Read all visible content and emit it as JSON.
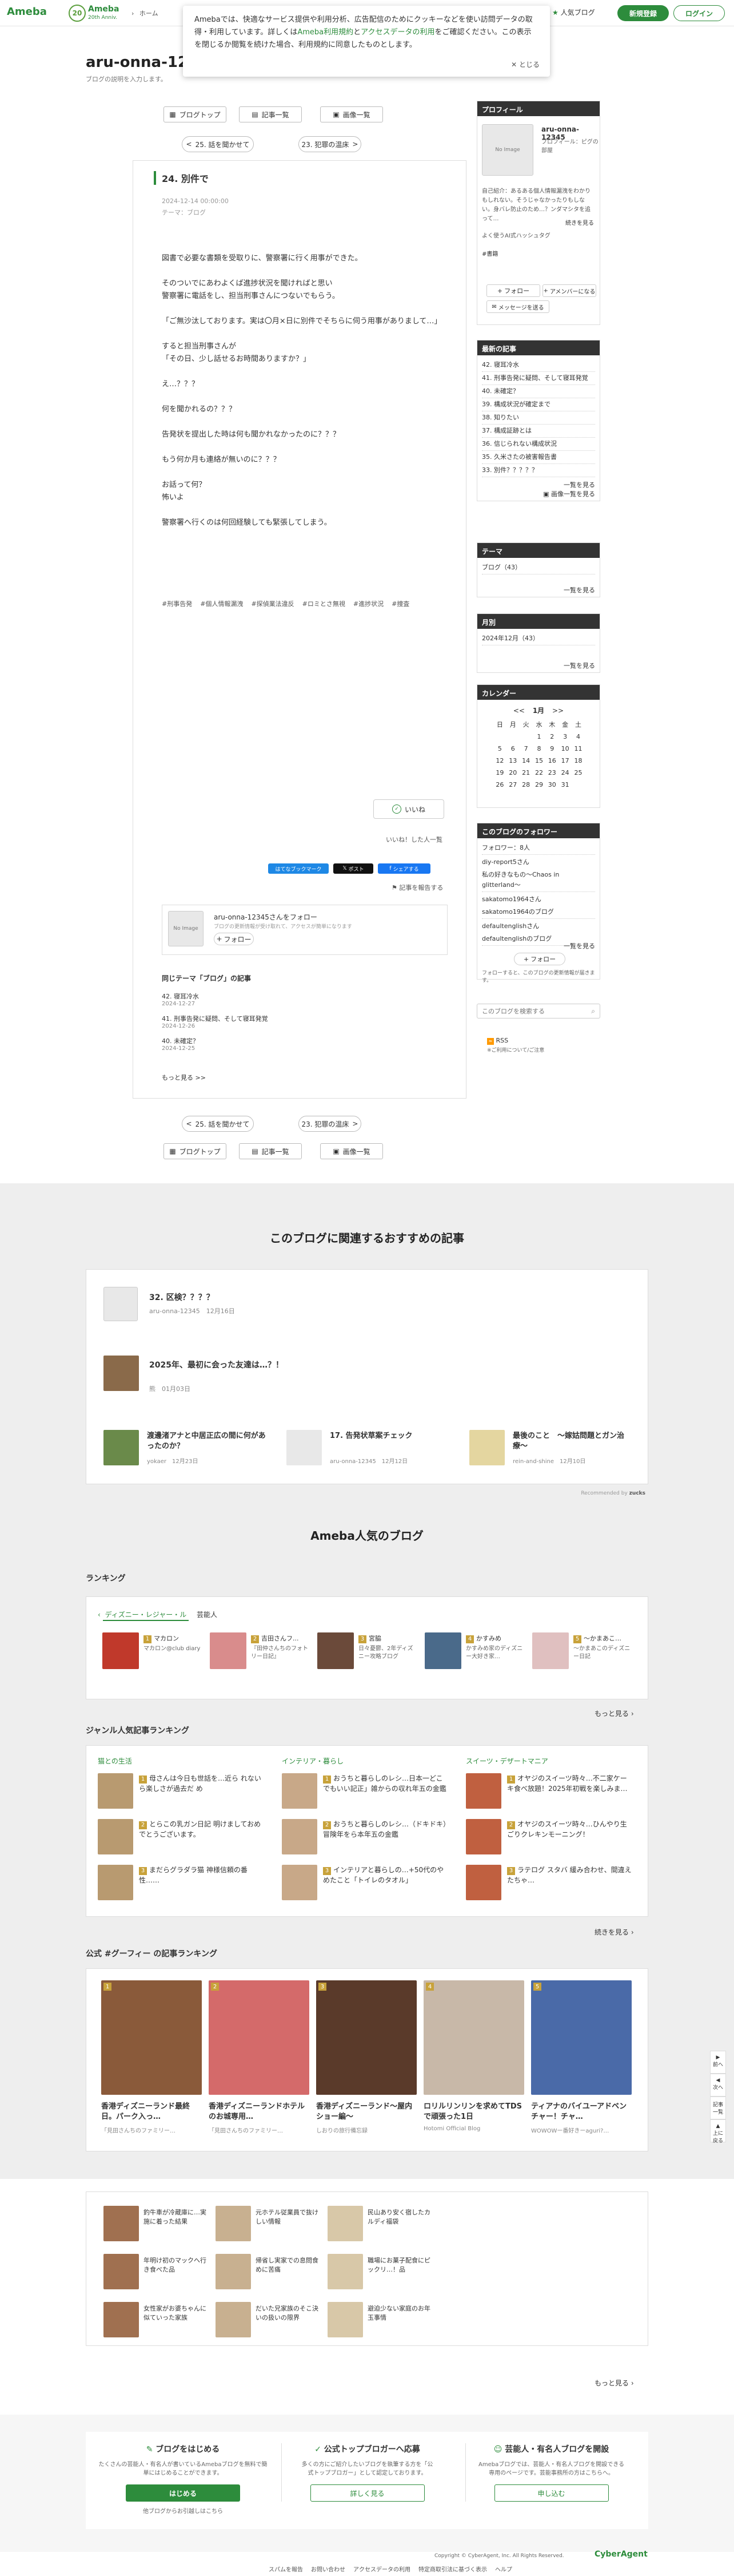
{
  "header": {
    "logo": "Ameba",
    "logo_sub": "20th Anniv.",
    "breadcrumb_home": "ホーム",
    "breadcrumb_sep": "›",
    "popular_blog": "人気ブログ",
    "signup": "新規登録",
    "login": "ログイン"
  },
  "cookie": {
    "text_1": "Amebaでは、快適なサービス提供や利用分析、広告配信のためにクッキーなどを使い訪問データの取得・利用しています。詳しくは",
    "link_terms": "Ameba利用規約",
    "text_2": "と",
    "link_data": "アクセスデータの利用",
    "text_3": "をご確認ください。この表示を閉じるか閲覧を続けた場合、利用規約に同意したものとします。",
    "close": "とじる"
  },
  "blog": {
    "title": "aru-onna-12345",
    "description": "ブログの説明を入力します。"
  },
  "nav": {
    "top": "ブログトップ",
    "list": "記事一覧",
    "images": "画像一覧",
    "prev": "25. 話を聞かせて",
    "next": "23. 犯罪の温床"
  },
  "article": {
    "title": "24. 別件で",
    "date": "2024-12-14 00:00:00",
    "theme_label": "テーマ：",
    "theme": "ブログ",
    "paragraphs": [
      "図書で必要な書類を受取りに、警察署に行く用事ができた。",
      "そのついでにあわよくば進捗状況を聞ければと思い\n警察署に電話をし、担当刑事さんにつないでもらう。",
      "「ご無沙汰しております。実は〇月×日に別件でそちらに伺う用事がありまして…」",
      "すると担当刑事さんが\n「その日、少し話せるお時間ありますか？」",
      "え…？？？",
      "何を聞かれるの？？？",
      "告発状を提出した時は何も聞かれなかったのに？？？",
      "もう何か月も連絡が無いのに？？？",
      "お話って何？\n怖いよ",
      "警察署へ行くのは何回経験しても緊張してしまう。"
    ],
    "tags": [
      "#刑事告発",
      "#個人情報漏洩",
      "#探偵業法違反",
      "#ロミとさ無視",
      "#進捗状況",
      "#捜査"
    ],
    "like": "いいね",
    "like_list": "いいね！した人一覧",
    "bookmark": "はてなブックマーク",
    "post": "ポスト",
    "share": "シェアする",
    "report": "記事を報告する"
  },
  "follow_box": {
    "title": "aru-onna-12345さんをフォロー",
    "sub": "ブログの更新情報が受け取れて、アクセスが簡単になります",
    "button": "フォロー",
    "no_image": "No Image"
  },
  "same_theme": {
    "header": "同じテーマ「ブログ」の記事",
    "items": [
      {
        "title": "42. 寝耳冷水",
        "date": "2024-12-27"
      },
      {
        "title": "41. 刑事告発に疑問、そして寝耳発覚",
        "date": "2024-12-26"
      },
      {
        "title": "40. 未確定？",
        "date": "2024-12-25"
      }
    ],
    "more": "もっと見る >>"
  },
  "sidebar": {
    "profile": {
      "head": "プロフィール",
      "name": "aru-onna-12345",
      "sub": "プロフィール：ピグの部屋",
      "bio": "自己紹介：あるある個人情報漏洩をわかりもしれない。そうじゃなかったりもしない。身バレ防止のため…？ンダマシタを追って…",
      "more": "続きを見る",
      "faq": "よく使うAI式ハッシュタグ",
      "tag": "#書籍",
      "follow": "フォロー",
      "amember": "アメンバーになる",
      "message": "メッセージを送る",
      "no_image": "No Image"
    },
    "recent": {
      "head": "最新の記事",
      "items": [
        "42. 寝耳冷水",
        "41. 刑事告発に疑問、そして寝耳発覚",
        "40. 未確定？",
        "39. 構成状況が確定まで",
        "38. 知りたい",
        "37. 構成証跡とは",
        "36. 信じられない構成状況",
        "35. 久米さたの被害報告書",
        "33. 別件？？？？？"
      ],
      "more": "一覧を見る",
      "more_img": "画像一覧を見る"
    },
    "theme": {
      "head": "テーマ",
      "items": [
        "ブログ（43）"
      ],
      "more": "一覧を見る"
    },
    "monthly": {
      "head": "月別",
      "items": [
        "2024年12月（43）"
      ],
      "more": "一覧を見る"
    },
    "calendar": {
      "head": "カレンダー",
      "month": "1月",
      "nav_prev": "<<",
      "nav_next": ">>",
      "days": [
        "日",
        "月",
        "火",
        "水",
        "木",
        "金",
        "土"
      ],
      "rows": [
        [
          "",
          "",
          "",
          "1",
          "2",
          "3",
          "4"
        ],
        [
          "5",
          "6",
          "7",
          "8",
          "9",
          "10",
          "11"
        ],
        [
          "12",
          "13",
          "14",
          "15",
          "16",
          "17",
          "18"
        ],
        [
          "19",
          "20",
          "21",
          "22",
          "23",
          "24",
          "25"
        ],
        [
          "26",
          "27",
          "28",
          "29",
          "30",
          "31",
          ""
        ]
      ]
    },
    "followers": {
      "head": "このブログのフォロワー",
      "count": "フォロワー：8人",
      "items": [
        "diy-report5さん",
        "私の好きなもの〜Chaos in glitterland〜",
        "sakatomo1964さん",
        "sakatomo1964のブログ",
        "defaultenglishさん",
        "defaultenglishのブログ"
      ],
      "follow": "フォロー",
      "note": "フォローすると、このブログの更新情報が届きます。",
      "more": "一覧を見る"
    },
    "search_placeholder": "このブログを検索する",
    "rss": "RSS",
    "rss_note": "※ご利用について/ご注意"
  },
  "recommend": {
    "title": "このブログに関連するおすすめの記事",
    "main": {
      "title": "32. 区検？？？？",
      "author": "aru-onna-12345",
      "date": "12月16日"
    },
    "row1": {
      "title": "2025年、最初に会った友達は…？！",
      "author": "熊",
      "date": "01月03日"
    },
    "row2": [
      {
        "title": "渡邊渚アナと中居正広の間に何があったのか？",
        "author": "yokaer",
        "date": "12月23日"
      },
      {
        "title": "17. 告発状草案チェック",
        "author": "aru-onna-12345",
        "date": "12月12日"
      },
      {
        "title": "最後のこと　〜嫁姑問題とガン治療〜",
        "author": "rein-and-shine",
        "date": "12月10日"
      }
    ],
    "powered": "Recommended by"
  },
  "popular": {
    "title": "Ameba人気のブログ",
    "ranking_head": "ランキング",
    "ranking_tab": "ディズニー・レジャー・ル",
    "ranking_tab2": "芸能人",
    "ranking_items": [
      {
        "rank": "1",
        "title": "マカロン",
        "sub": "マカロン@club diary"
      },
      {
        "rank": "2",
        "title": "吉田さんフ...",
        "sub": "『田仲さんちのフォトリー日記』"
      },
      {
        "rank": "3",
        "title": "宮脇",
        "sub": "日々憂鬱、2年ディズニー攻略ブログ"
      },
      {
        "rank": "4",
        "title": "かすみめ",
        "sub": "かすみめ家のディズニー大好き家…"
      },
      {
        "rank": "5",
        "title": "～かまあこ…",
        "sub": "～かまあこのディズニー日記"
      }
    ],
    "more": "もっと見る",
    "genre_head": "ジャンル人気記事ランキング",
    "genres": [
      {
        "name": "猫との生活",
        "items": [
          "母さんは今日も世話を…近ら れないら楽しさが過去だ め",
          "とらこの乳ガン日記 明けましておめでとうございます。",
          "まだらグラダラ猫 神様信頼の番性……"
        ]
      },
      {
        "name": "インテリア・暮らし",
        "items": [
          "おうちと暮らしのレシ…日本一どこでもいい記正」雑からの収れ年五の金鑑",
          "おうちと暮らしのレシ…（ドキドキ）冒険年をら本年五の金鑑",
          "インテリアと暮らしの…+50代のやめたこと「トイレのタオル」"
        ]
      },
      {
        "name": "スイーツ・デザートマニア",
        "items": [
          "オヤジのスイーツ時々…不二家ケーキ食べ放題！2025年初戦を楽しみま…",
          "オヤジのスイーツ時々…ひんやり生ごりクレキンモーニング！",
          "ラテログ スタバ 緩み合わせ、間違えたちゃ…"
        ]
      }
    ],
    "genre_more": "続きを見る",
    "official_head": "公式 #グーフィー の記事ランキング",
    "official": [
      {
        "rank": "1",
        "title": "香港ディズニーランド最終日。パーク入っ…",
        "sub": "「見田さんちのファミリー…"
      },
      {
        "rank": "2",
        "title": "香港ディズニーランドホテルのお城専用…",
        "sub": "「見田さんちのファミリー…"
      },
      {
        "rank": "3",
        "title": "香港ディズニーランド〜屋内ショー編〜",
        "sub": "しおりの旅行備忘録"
      },
      {
        "rank": "4",
        "title": "ロリルリンリンを求めてTDSで頑張った1日",
        "sub": "Hotomi Official Blog"
      },
      {
        "rank": "5",
        "title": "ティアナのバイユーアドベンチャー！チャ…",
        "sub": "WOWOWー番好きーaguri?…"
      }
    ],
    "extra": [
      "釣牛車が冷蔵庫に…実施に着った結果",
      "元ホテル従業員で抜けしい情報",
      "民山あり安く宿したカルディ福袋",
      "年明け初のマックへ行き食べた品",
      "帰省し実家での息問食めに苦痛",
      "職場にお菓子配食にピックリ…！品",
      "女性家がお婆ちゃんに似ていった家族",
      "だいた兄家族のそこ決いの扱いの限界",
      "避迫少ない家庭のお年玉事情"
    ],
    "extra_more": "もっと見る"
  },
  "footer": {
    "col1_head": "ブログをはじめる",
    "col1_text": "たくさんの芸能人・有名人が書いているAmebaブログを無料で簡単にはじめることができます。",
    "col1_btn": "はじめる",
    "col1_link": "他ブログからお引越しはこちら",
    "col2_head": "公式トップブロガーへ応募",
    "col2_text": "多くの方にご紹介したいブログを執筆する方を「公式トップブロガー」として認定しております。",
    "col2_btn": "詳しく見る",
    "col3_head": "芸能人・有名人ブログを開設",
    "col3_text": "Amebaブログでは、芸能人・有名人ブログを開設できる専用のページです。芸能事務所の方はこちらへ。",
    "col3_btn": "申し込む",
    "copyright": "Copyright © CyberAgent, Inc. All Rights Reserved.",
    "company": "CyberAgent",
    "links": [
      "スパムを報告",
      "お問い合わせ",
      "アクセスデータの利用",
      "特定商取引法に基づく表示",
      "ヘルプ"
    ]
  },
  "float": {
    "top": "上へ",
    "down": "次へ",
    "prev": "前へ",
    "list": "記事一覧",
    "up": "上に戻る"
  }
}
